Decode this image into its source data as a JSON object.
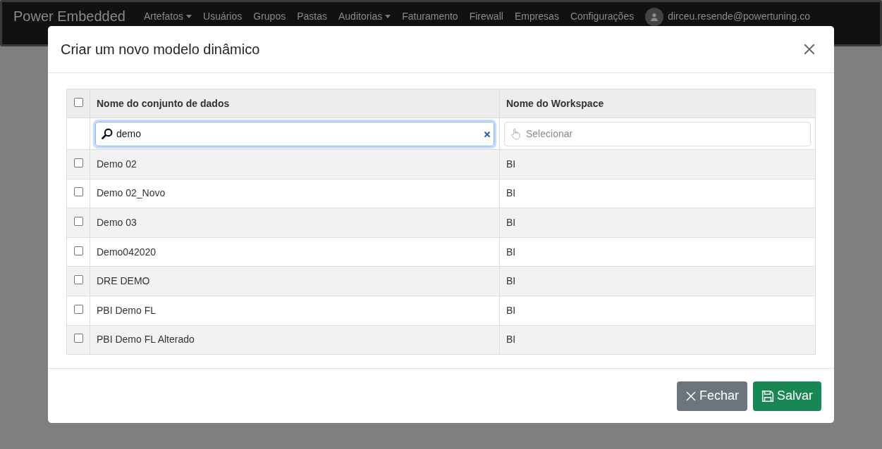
{
  "navbar": {
    "brand": "Power Embedded",
    "items": [
      {
        "label": "Artefatos",
        "dropdown": true
      },
      {
        "label": "Usuários",
        "dropdown": false
      },
      {
        "label": "Grupos",
        "dropdown": false
      },
      {
        "label": "Pastas",
        "dropdown": false
      },
      {
        "label": "Auditorias",
        "dropdown": true
      },
      {
        "label": "Faturamento",
        "dropdown": false
      },
      {
        "label": "Firewall",
        "dropdown": false
      },
      {
        "label": "Empresas",
        "dropdown": false
      },
      {
        "label": "Configurações",
        "dropdown": false
      }
    ],
    "user": "dirceu.resende@powertuning.co"
  },
  "dialog": {
    "title": "Criar um novo modelo dinâmico",
    "table": {
      "select_all_checked": false,
      "columns": [
        "Nome do conjunto de dados",
        "Nome do Workspace"
      ],
      "filters": {
        "name": {
          "value": "demo"
        },
        "workspace": {
          "placeholder": "Selecionar"
        }
      },
      "rows": [
        {
          "checked": false,
          "name": "Demo 02",
          "workspace": "BI"
        },
        {
          "checked": false,
          "name": "Demo 02_Novo",
          "workspace": "BI"
        },
        {
          "checked": false,
          "name": "Demo 03",
          "workspace": "BI"
        },
        {
          "checked": false,
          "name": "Demo042020",
          "workspace": "BI"
        },
        {
          "checked": false,
          "name": "DRE DEMO",
          "workspace": "BI"
        },
        {
          "checked": false,
          "name": "PBI Demo FL",
          "workspace": "BI"
        },
        {
          "checked": false,
          "name": "PBI Demo FL Alterado",
          "workspace": "BI"
        }
      ]
    },
    "buttons": [
      {
        "kind": "close",
        "label": "Fechar"
      },
      {
        "kind": "save",
        "label": "Salvar"
      }
    ]
  }
}
